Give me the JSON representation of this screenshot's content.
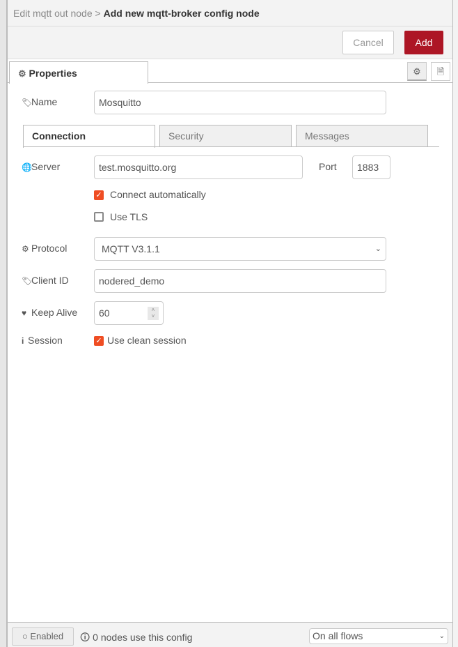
{
  "header": {
    "crumb": "Edit mqtt out node",
    "separator": ">",
    "title": "Add new mqtt-broker config node"
  },
  "toolbar": {
    "cancel": "Cancel",
    "add": "Add",
    "add_color": "#ad1625"
  },
  "tabs": {
    "properties": "Properties"
  },
  "form": {
    "name_label": "Name",
    "name_value": "Mosquitto",
    "conn_tabs": [
      "Connection",
      "Security",
      "Messages"
    ],
    "server_label": "Server",
    "server_value": "test.mosquitto.org",
    "port_label": "Port",
    "port_value": "1883",
    "connect_auto": {
      "label": "Connect automatically",
      "checked": true
    },
    "use_tls": {
      "label": "Use TLS",
      "checked": false
    },
    "protocol_label": "Protocol",
    "protocol_value": "MQTT V3.1.1",
    "clientid_label": "Client ID",
    "clientid_value": "nodered_demo",
    "keepalive_label": "Keep Alive",
    "keepalive_value": "60",
    "session_label": "Session",
    "clean_session": {
      "label": "Use clean session",
      "checked": true
    },
    "checkbox_color": "#ef4d23"
  },
  "footer": {
    "enabled": "Enabled",
    "usage": "0 nodes use this config",
    "scope": "On all flows"
  }
}
